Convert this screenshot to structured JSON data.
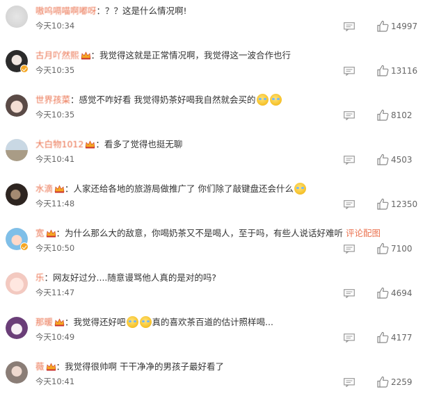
{
  "comments": [
    {
      "avatar": "avatar-gray",
      "username": "嗷呜嗝喵啊嘟呀",
      "text_parts": [
        {
          "t": "text",
          "v": "：？？这是什么情况啊!"
        }
      ],
      "time": "今天10:34",
      "likes": "14997",
      "verified": false,
      "crown": false
    },
    {
      "avatar": "avatar-dark",
      "username": "古月吖然熙",
      "text_parts": [
        {
          "t": "text",
          "v": "：我觉得这就是正常情况啊，我觉得这一波合作也行"
        }
      ],
      "time": "今天10:35",
      "likes": "13116",
      "verified": true,
      "crown": true
    },
    {
      "avatar": "avatar-girl",
      "username": "世界孩菜",
      "text_parts": [
        {
          "t": "text",
          "v": "：感觉不咋好看 我觉得奶茶好喝我自然就会买的"
        },
        {
          "t": "emoji",
          "v": "crying-laughing-emoji"
        },
        {
          "t": "emoji",
          "v": "crying-laughing-emoji"
        }
      ],
      "time": "今天10:35",
      "likes": "8102",
      "verified": false,
      "crown": false
    },
    {
      "avatar": "avatar-beach",
      "username": "大白物1012",
      "text_parts": [
        {
          "t": "text",
          "v": "：看多了觉得也挺无聊"
        }
      ],
      "time": "今天10:41",
      "likes": "4503",
      "verified": false,
      "crown": true
    },
    {
      "avatar": "avatar-dark2",
      "username": "水滴",
      "text_parts": [
        {
          "t": "text",
          "v": "：人家还给各地的旅游局做推广了 你们除了敲键盘还会什么"
        },
        {
          "t": "emoji",
          "v": "sweat-emoji"
        }
      ],
      "time": "今天11:48",
      "likes": "12350",
      "verified": false,
      "crown": true
    },
    {
      "avatar": "avatar-cartoon",
      "username": "宽",
      "text_parts": [
        {
          "t": "text",
          "v": "：为什么那么大的敌意，你喝奶茶又不是喝人，至于吗，有些人说话好难听 "
        },
        {
          "t": "link",
          "v": "评论配图"
        }
      ],
      "time": "今天10:50",
      "likes": "7100",
      "verified": true,
      "crown": true
    },
    {
      "avatar": "avatar-baby",
      "username": "乐",
      "text_parts": [
        {
          "t": "text",
          "v": "：网友好过分....随意谩骂他人真的是对的吗?"
        }
      ],
      "time": "今天11:47",
      "likes": "4694",
      "verified": false,
      "crown": false
    },
    {
      "avatar": "avatar-anime",
      "username": "那暖",
      "text_parts": [
        {
          "t": "text",
          "v": "：我觉得还好吧"
        },
        {
          "t": "emoji",
          "v": "crying-emoji"
        },
        {
          "t": "emoji",
          "v": "crying-emoji"
        },
        {
          "t": "text",
          "v": "真的喜欢茶百道的估计照样喝..."
        }
      ],
      "time": "今天10:49",
      "likes": "4177",
      "verified": false,
      "crown": true
    },
    {
      "avatar": "avatar-girl2",
      "username": "薇",
      "text_parts": [
        {
          "t": "text",
          "v": "：我觉得很帅啊 干干净净的男孩子最好看了"
        }
      ],
      "time": "今天10:41",
      "likes": "2259",
      "verified": false,
      "crown": true
    }
  ],
  "colors": {
    "username": "#eb7350",
    "text": "#333333",
    "meta": "#666666",
    "crown": "#f5a623"
  }
}
